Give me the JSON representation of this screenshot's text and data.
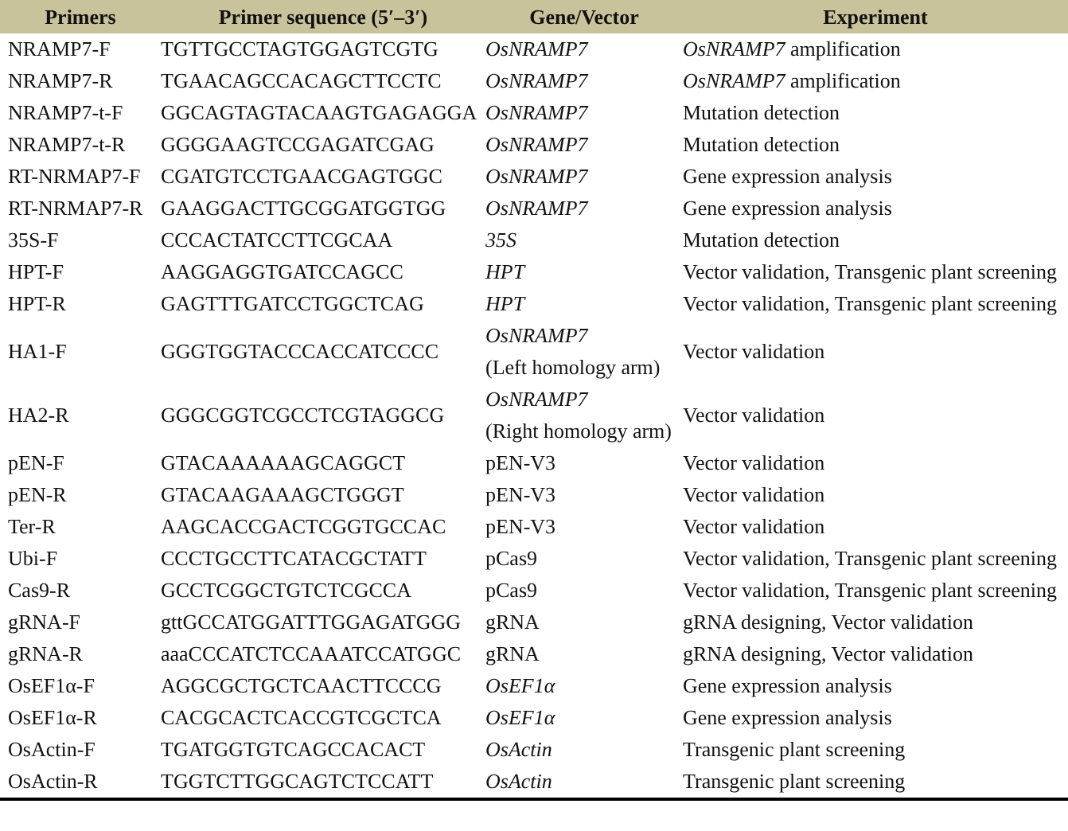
{
  "table": {
    "columns": [
      "Primers",
      "Primer sequence (5′–3′)",
      "Gene/Vector",
      "Experiment"
    ],
    "rows": [
      {
        "primer": "NRAMP7-F",
        "sequence": "TGTTGCCTAGTGGAGTCGTG",
        "gene": {
          "text": "OsNRAMP7",
          "italic": true
        },
        "experiment": "*OsNRAMP7* amplification"
      },
      {
        "primer": "NRAMP7-R",
        "sequence": "TGAACAGCCACAGCTTCCTC",
        "gene": {
          "text": "OsNRAMP7",
          "italic": true
        },
        "experiment": "*OsNRAMP7* amplification"
      },
      {
        "primer": "NRAMP7-t-F",
        "sequence": "GGCAGTAGTACAAGTGAGAGGA",
        "gene": {
          "text": "OsNRAMP7",
          "italic": true
        },
        "experiment": "Mutation detection"
      },
      {
        "primer": "NRAMP7-t-R",
        "sequence": "GGGGAAGTCCGAGATCGAG",
        "gene": {
          "text": "OsNRAMP7",
          "italic": true
        },
        "experiment": "Mutation detection"
      },
      {
        "primer": "RT-NRMAP7-F",
        "sequence": "CGATGTCCTGAACGAGTGGC",
        "gene": {
          "text": "OsNRAMP7",
          "italic": true
        },
        "experiment": "Gene expression analysis"
      },
      {
        "primer": "RT-NRMAP7-R",
        "sequence": "GAAGGACTTGCGGATGGTGG",
        "gene": {
          "text": "OsNRAMP7",
          "italic": true
        },
        "experiment": "Gene expression analysis"
      },
      {
        "primer": "35S-F",
        "sequence": "CCCACTATCCTTCGCAA",
        "gene": {
          "text": "35S",
          "italic": true
        },
        "experiment": "Mutation detection"
      },
      {
        "primer": "HPT-F",
        "sequence": "AAGGAGGTGATCCAGCC",
        "gene": {
          "text": "HPT",
          "italic": true
        },
        "experiment": "Vector validation, Transgenic plant screening"
      },
      {
        "primer": "HPT-R",
        "sequence": "GAGTTTGATCCTGGCTCAG",
        "gene": {
          "text": "HPT",
          "italic": true
        },
        "experiment": "Vector validation, Transgenic plant screening"
      },
      {
        "primer": "HA1-F",
        "sequence": "GGGTGGTACCCACCATCCCC",
        "gene": {
          "text": "OsNRAMP7",
          "italic": true,
          "note": "(Left homology arm)"
        },
        "experiment": "Vector validation"
      },
      {
        "primer": "HA2-R",
        "sequence": "GGGCGGTCGCCTCGTAGGCG",
        "gene": {
          "text": "OsNRAMP7",
          "italic": true,
          "note": "(Right homology arm)"
        },
        "experiment": "Vector validation"
      },
      {
        "primer": "pEN-F",
        "sequence": "GTACAAAAAAGCAGGCT",
        "gene": {
          "text": "pEN-V3",
          "italic": false
        },
        "experiment": "Vector validation"
      },
      {
        "primer": "pEN-R",
        "sequence": "GTACAAGAAAGCTGGGT",
        "gene": {
          "text": "pEN-V3",
          "italic": false
        },
        "experiment": "Vector validation"
      },
      {
        "primer": "Ter-R",
        "sequence": "AAGCACCGACTCGGTGCCAC",
        "gene": {
          "text": "pEN-V3",
          "italic": false
        },
        "experiment": "Vector validation"
      },
      {
        "primer": "Ubi-F",
        "sequence": "CCCTGCCTTCATACGCTATT",
        "gene": {
          "text": "pCas9",
          "italic": false
        },
        "experiment": "Vector validation, Transgenic plant screening"
      },
      {
        "primer": "Cas9-R",
        "sequence": "GCCTCGGCTGTCTCGCCA",
        "gene": {
          "text": "pCas9",
          "italic": false
        },
        "experiment": "Vector validation, Transgenic plant screening"
      },
      {
        "primer": "gRNA-F",
        "sequence": "gttGCCATGGATTTGGAGATGGG",
        "gene": {
          "text": "gRNA",
          "italic": false
        },
        "experiment": "gRNA designing, Vector validation"
      },
      {
        "primer": "gRNA-R",
        "sequence": "aaaCCCATCTCCAAATCCATGGC",
        "gene": {
          "text": "gRNA",
          "italic": false
        },
        "experiment": "gRNA designing, Vector validation"
      },
      {
        "primer": "OsEF1α-F",
        "sequence": "AGGCGCTGCTCAACTTCCCG",
        "gene": {
          "text": "OsEF1α",
          "italic": true
        },
        "experiment": "Gene expression analysis"
      },
      {
        "primer": "OsEF1α-R",
        "sequence": "CACGCACTCACCGTCGCTCA",
        "gene": {
          "text": "OsEF1α",
          "italic": true
        },
        "experiment": "Gene expression analysis"
      },
      {
        "primer": "OsActin-F",
        "sequence": "TGATGGTGTCAGCCACACT",
        "gene": {
          "text": "OsActin",
          "italic": true
        },
        "experiment": "Transgenic plant screening"
      },
      {
        "primer": "OsActin-R",
        "sequence": "TGGTCTTGGCAGTCTCCATT",
        "gene": {
          "text": "OsActin",
          "italic": true
        },
        "experiment": "Transgenic plant screening"
      }
    ]
  }
}
